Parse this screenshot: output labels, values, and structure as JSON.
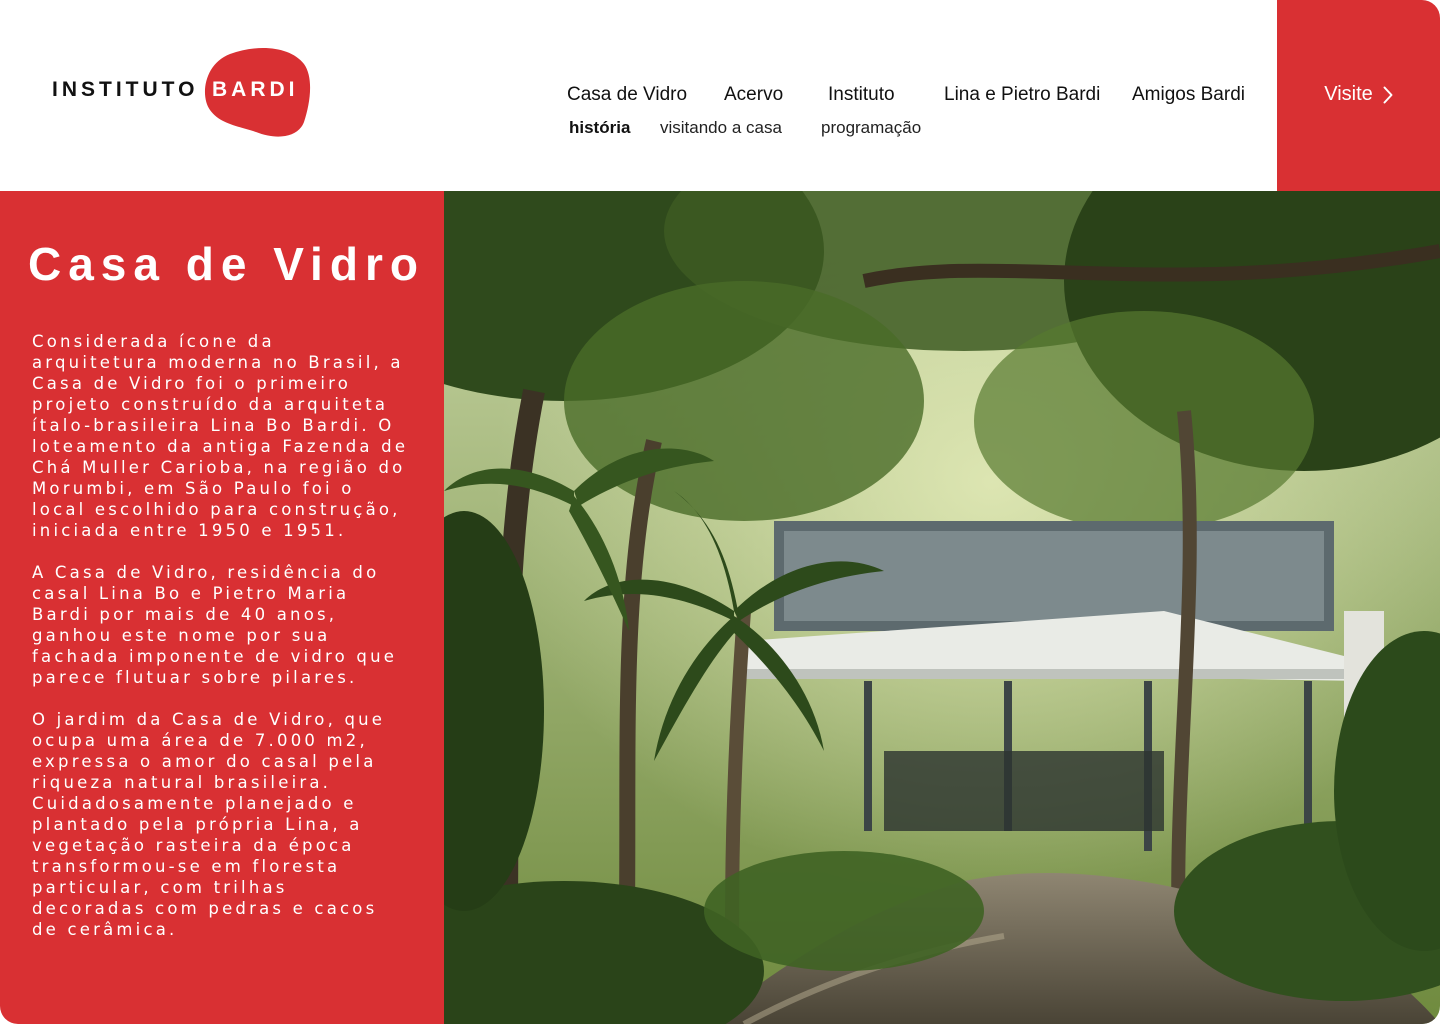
{
  "logo": {
    "left_text": "INSTITUTO",
    "right_text": "BARDI",
    "brand_color": "#d93033"
  },
  "nav": {
    "items": [
      {
        "label": "Casa de Vidro"
      },
      {
        "label": "Acervo"
      },
      {
        "label": "Instituto"
      },
      {
        "label": "Lina e Pietro Bardi"
      },
      {
        "label": "Amigos Bardi"
      }
    ],
    "subitems": [
      {
        "label": "história",
        "active": true
      },
      {
        "label": "visitando a casa",
        "active": false
      },
      {
        "label": "programação",
        "active": false
      }
    ]
  },
  "visit": {
    "label": "Visite",
    "icon": "chevron-right-icon"
  },
  "main": {
    "title": "Casa de Vidro",
    "paragraphs": [
      "Considerada ícone da arquitetura moderna no Brasil, a Casa de Vidro foi o primeiro projeto construído da arquiteta ítalo-brasileira Lina Bo Bardi. O loteamento da antiga Fazenda de Chá Muller Carioba, na região do Morumbi, em São Paulo foi o local escolhido para construção, iniciada entre 1950 e 1951.",
      "A Casa de Vidro, residência do casal Lina Bo e Pietro Maria Bardi por mais de 40 anos, ganhou este nome por sua fachada imponente de vidro que parece flutuar sobre pilares.",
      "O jardim da Casa de Vidro, que ocupa uma área de 7.000 m2, expressa o amor do casal pela riqueza natural brasileira. Cuidadosamente planejado e plantado pela própria Lina, a vegetação rasteira da época transformou-se em floresta particular, com trilhas decoradas com pedras e cacos de cerâmica."
    ]
  },
  "colors": {
    "accent": "#d93033",
    "text": "#111111",
    "background": "#ffffff"
  }
}
